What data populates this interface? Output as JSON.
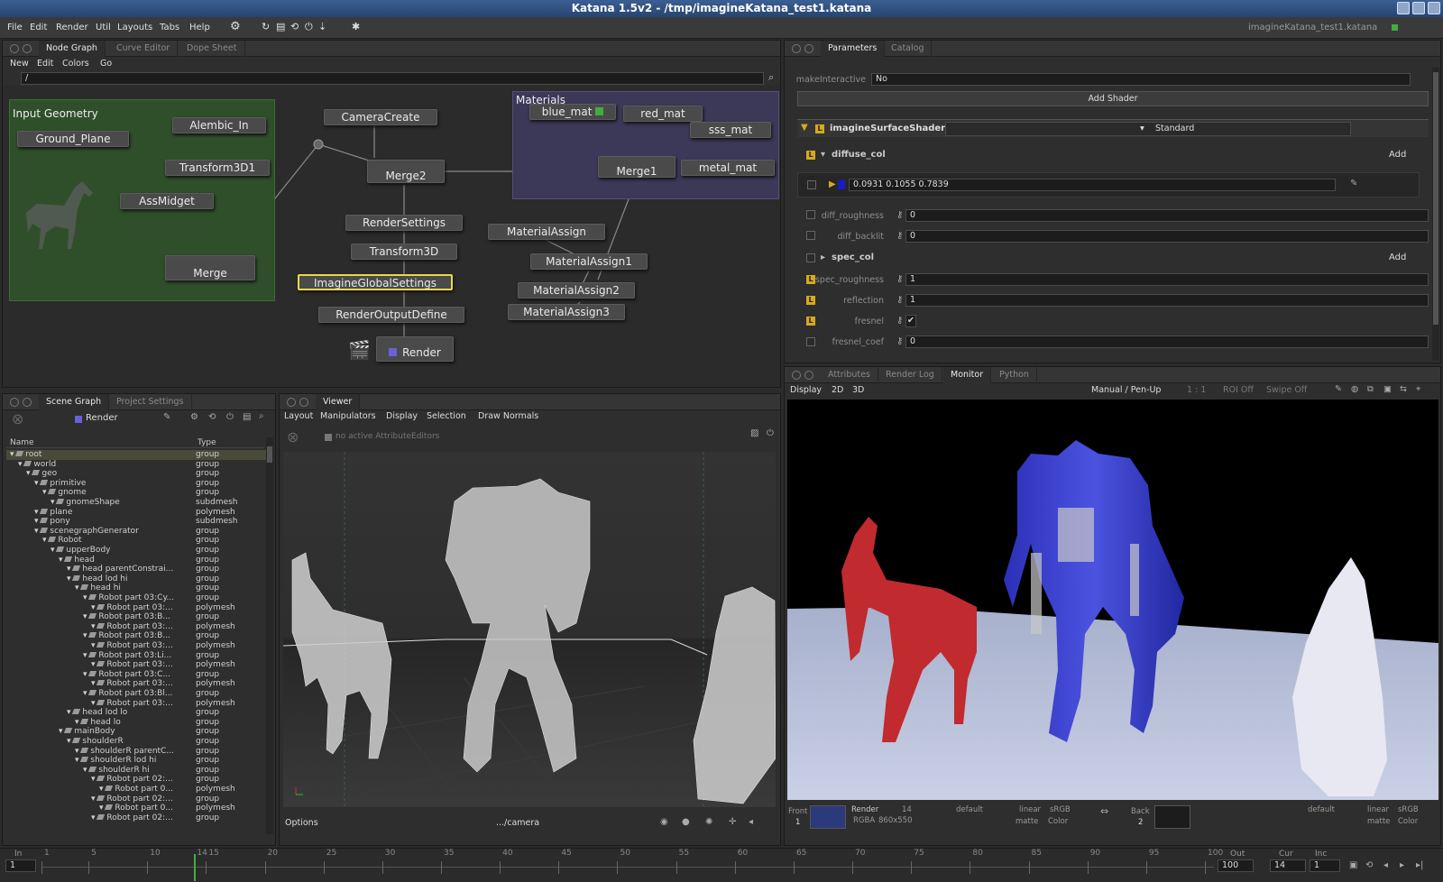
{
  "window": {
    "title": "Katana 1.5v2 - /tmp/imagineKatana_test1.katana",
    "file_label": "imagineKatana_test1.katana"
  },
  "menu": [
    "File",
    "Edit",
    "Render",
    "Util",
    "Layouts",
    "Tabs",
    "Help"
  ],
  "nodegraph": {
    "tabs": [
      "Node Graph",
      "Curve Editor",
      "Dope Sheet"
    ],
    "menu": [
      "New",
      "Edit",
      "Colors",
      "Go"
    ],
    "path": "/",
    "backdrops": {
      "input": "Input Geometry",
      "materials": "Materials"
    },
    "nodes": {
      "ground": "Ground_Plane",
      "alembic": "Alembic_In",
      "transform1": "Transform3D1",
      "assmidget": "AssMidget",
      "merge": "Merge",
      "camera": "CameraCreate",
      "merge2": "Merge2",
      "rendersettings": "RenderSettings",
      "transform3d": "Transform3D",
      "imagine": "ImagineGlobalSettings",
      "outputdefine": "RenderOutputDefine",
      "render": "Render",
      "blue": "blue_mat",
      "red": "red_mat",
      "sss": "sss_mat",
      "merge1": "Merge1",
      "metal": "metal_mat",
      "ma": "MaterialAssign",
      "ma1": "MaterialAssign1",
      "ma2": "MaterialAssign2",
      "ma3": "MaterialAssign3"
    }
  },
  "params": {
    "tabs": [
      "Parameters",
      "Catalog"
    ],
    "make_label": "makeInteractive",
    "make_value": "No",
    "add_shader": "Add Shader",
    "shader_name": "imagineSurfaceShader",
    "shader_type": "Standard",
    "diffuse": "diffuse_col",
    "add": "Add",
    "diffuse_value": "0.0931  0.1055  0.7839",
    "rows": [
      {
        "label": "diff_roughness",
        "value": "0"
      },
      {
        "label": "diff_backlit",
        "value": "0"
      }
    ],
    "spec": "spec_col",
    "rows2": [
      {
        "label": "spec_roughness",
        "value": "1"
      },
      {
        "label": "reflection",
        "value": "1"
      },
      {
        "label": "fresnel",
        "value": "✔"
      },
      {
        "label": "fresnel_coef",
        "value": "0"
      }
    ]
  },
  "scenegraph": {
    "tabs": [
      "Scene Graph",
      "Project Settings"
    ],
    "render": "Render",
    "col_name": "Name",
    "col_type": "Type",
    "rows": [
      [
        "root",
        "group",
        0
      ],
      [
        "world",
        "group",
        1
      ],
      [
        "geo",
        "group",
        2
      ],
      [
        "primitive",
        "group",
        3
      ],
      [
        "gnome",
        "group",
        4
      ],
      [
        "gnomeShape",
        "subdmesh",
        5
      ],
      [
        "plane",
        "polymesh",
        3
      ],
      [
        "pony",
        "subdmesh",
        3
      ],
      [
        "scenegraphGenerator",
        "group",
        3
      ],
      [
        "Robot",
        "group",
        4
      ],
      [
        "upperBody",
        "group",
        5
      ],
      [
        "head",
        "group",
        6
      ],
      [
        "head parentConstrai...",
        "group",
        7
      ],
      [
        "head lod hi",
        "group",
        7
      ],
      [
        "head hi",
        "group",
        8
      ],
      [
        "Robot part 03:Cy...",
        "group",
        9
      ],
      [
        "Robot part 03:...",
        "polymesh",
        10
      ],
      [
        "Robot part 03:B...",
        "group",
        9
      ],
      [
        "Robot part 03:...",
        "polymesh",
        10
      ],
      [
        "Robot part 03:B...",
        "group",
        9
      ],
      [
        "Robot part 03:...",
        "polymesh",
        10
      ],
      [
        "Robot part 03:Li...",
        "group",
        9
      ],
      [
        "Robot part 03:...",
        "polymesh",
        10
      ],
      [
        "Robot part 03:C...",
        "group",
        9
      ],
      [
        "Robot part 03:...",
        "polymesh",
        10
      ],
      [
        "Robot part 03:Bl...",
        "group",
        9
      ],
      [
        "Robot part 03:...",
        "polymesh",
        10
      ],
      [
        "head lod lo",
        "group",
        7
      ],
      [
        "head lo",
        "group",
        8
      ],
      [
        "mainBody",
        "group",
        6
      ],
      [
        "shoulderR",
        "group",
        7
      ],
      [
        "shoulderR parentC...",
        "group",
        8
      ],
      [
        "shoulderR lod hi",
        "group",
        8
      ],
      [
        "shoulderR hi",
        "group",
        9
      ],
      [
        "Robot part 02:...",
        "group",
        10
      ],
      [
        "Robot part 0...",
        "polymesh",
        11
      ],
      [
        "Robot part 02:...",
        "group",
        10
      ],
      [
        "Robot part 0...",
        "polymesh",
        11
      ],
      [
        "Robot part 02:...",
        "group",
        10
      ]
    ]
  },
  "viewer": {
    "tabs": [
      "Viewer"
    ],
    "menu": [
      "Layout",
      "Manipulators",
      "Display",
      "Selection",
      "Draw Normals"
    ],
    "no_editors": "no active AttributeEditors",
    "options": "Options",
    "camera": ".../camera"
  },
  "monitor": {
    "tabs": [
      "Attributes",
      "Render Log",
      "Monitor",
      "Python"
    ],
    "display": [
      "Display",
      "2D",
      "3D"
    ],
    "mode": "Manual / Pen-Up",
    "ratio": "1 : 1",
    "roi": "ROI Off",
    "swipe": "Swipe Off",
    "front": "Front",
    "front_n": "1",
    "render": "Render",
    "render_n": "14",
    "rgba": "RGBA",
    "res": "860x550",
    "default": "default",
    "linear": "linear",
    "srgb": "sRGB",
    "matte": "matte",
    "color": "Color",
    "back": "Back",
    "back_n": "2"
  },
  "timeline": {
    "in_label": "In",
    "in": "1",
    "out_label": "Out",
    "out": "100",
    "cur_label": "Cur",
    "cur": "14",
    "inc_label": "Inc",
    "inc": "1",
    "ticks": [
      "1",
      "5",
      "10",
      "14",
      "15",
      "20",
      "25",
      "30",
      "35",
      "40",
      "45",
      "50",
      "55",
      "60",
      "65",
      "70",
      "75",
      "80",
      "85",
      "90",
      "95",
      "100"
    ]
  },
  "colors": {
    "accent": "#d8a91d",
    "input_backdrop": "#2f4f2a",
    "materials_backdrop": "#3c3858"
  }
}
